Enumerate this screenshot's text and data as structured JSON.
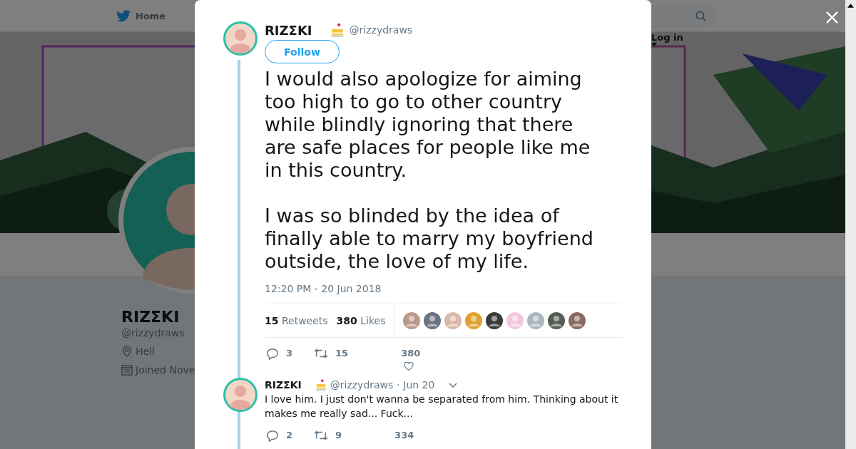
{
  "nav": {
    "home": "Home",
    "login": "Log in"
  },
  "profile": {
    "name": "RIZΣKI",
    "handle": "@rizzydraws",
    "location": "Hell",
    "joined": "Joined Nove"
  },
  "tweet": {
    "name": "RIZΣKI",
    "handle": "@rizzydraws",
    "follow": "Follow",
    "paragraphs": [
      "I would also apologize for aiming too high to go to other country while blindly ignoring that there are safe places for people like me in this country.",
      "I was so blinded by the idea of finally able to marry my boyfriend outside, the love of my life."
    ],
    "time": "12:20 PM - 20 Jun 2018",
    "retweet_count": "15",
    "retweet_label": "Retweets",
    "like_count": "380",
    "like_label": "Likes",
    "likers": [
      {
        "color": "#b89a86"
      },
      {
        "color": "#6b7280"
      },
      {
        "color": "#d9b8a8"
      },
      {
        "color": "#e0a030"
      },
      {
        "color": "#3a3a3a"
      },
      {
        "color": "#f2c8e0"
      },
      {
        "color": "#aab8c2"
      },
      {
        "color": "#555d55"
      },
      {
        "color": "#8a6a60"
      }
    ],
    "actions": {
      "replies": "3",
      "retweets": "15",
      "likes": "380"
    }
  },
  "replies": [
    {
      "name": "RIZΣKI",
      "handle": "@rizzydraws",
      "date": "· Jun 20",
      "text": "I love him. I just don't wanna be separated from him. Thinking about it makes me really sad... Fuck...",
      "replies": "2",
      "retweets": "9",
      "likes": "334"
    }
  ]
}
